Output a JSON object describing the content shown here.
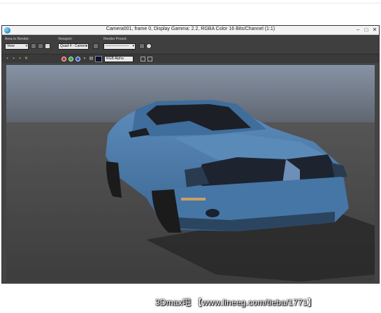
{
  "window": {
    "title": "Camera001, frame 0, Display Gamma: 2.2, RGBA Color 16 Bits/Channel (1:1)",
    "controls": {
      "minimize": "–",
      "maximize": "□",
      "close": "✕"
    }
  },
  "toolbar": {
    "area_label": "Area to Render:",
    "area_value": "View",
    "viewport_label": "Viewport:",
    "viewport_value": "Quad 4 - Camera",
    "preset_label": "Render Preset:",
    "preset_value": "--------------------",
    "channel_value": "RGB Alpha"
  },
  "channel_dots": {
    "red": "#e0302a",
    "green": "#2fb04a",
    "blue": "#2a58d8"
  },
  "watermark": "3Dmax吧  【www.lineeg.com/tieba/1771】",
  "colors": {
    "car_body": "#4a78a8",
    "sky_top": "#8a96a8",
    "floor": "#505050"
  }
}
